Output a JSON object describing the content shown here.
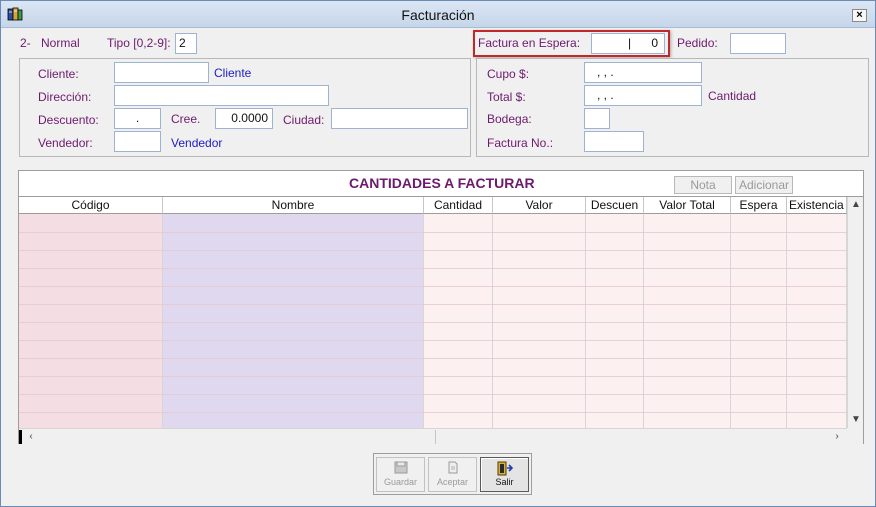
{
  "window": {
    "title": "Facturación",
    "close_label": "×"
  },
  "top": {
    "mode_number": "2-",
    "mode_label": "Normal",
    "tipo_label": "Tipo [0,2-9]:",
    "tipo_value": "2",
    "espera_label": "Factura en Espera:",
    "espera_cursor": "|",
    "espera_value": "0",
    "pedido_label": "Pedido:",
    "pedido_value": ""
  },
  "left_panel": {
    "cliente_label": "Cliente:",
    "cliente_value": "",
    "cliente_name": "Cliente",
    "direccion_label": "Dirección:",
    "direccion_value": "",
    "descuento_label": "Descuento:",
    "descuento_value": ".",
    "cree_label": "Cree.",
    "cree_value": "0.0000",
    "ciudad_label": "Ciudad:",
    "ciudad_value": "",
    "vendedor_label": "Vendedor:",
    "vendedor_value": "",
    "vendedor_name": "Vendedor"
  },
  "right_panel": {
    "cupo_label": "Cupo $:",
    "cupo_value": ",  ,  .",
    "total_label": "Total $:",
    "total_value": ",  ,  .",
    "cantidad_label": "Cantidad",
    "bodega_label": "Bodega:",
    "bodega_value": "",
    "factura_label": "Factura No.:",
    "factura_value": ""
  },
  "grid": {
    "caption": "CANTIDADES A FACTURAR",
    "nota_button": "Nota",
    "adicionar_button": "Adicionar",
    "columns": [
      "Código",
      "Nombre",
      "Cantidad",
      "Valor",
      "Descuen",
      "Valor Total",
      "Espera",
      "Existencia"
    ],
    "rows": []
  },
  "actions": {
    "guardar": "Guardar",
    "aceptar": "Aceptar",
    "salir": "Salir"
  },
  "colors": {
    "label": "#6d1a6d",
    "link_blue": "#1c1cc8",
    "highlight_border": "#c0282a",
    "codigo_col": "#f4dde3",
    "nombre_col": "#e0d8ef",
    "other_cols": "#fdf0f0"
  },
  "icons": {
    "app": "database-icon",
    "guardar": "floppy-disk-icon",
    "aceptar": "document-icon",
    "salir": "exit-door-icon"
  }
}
